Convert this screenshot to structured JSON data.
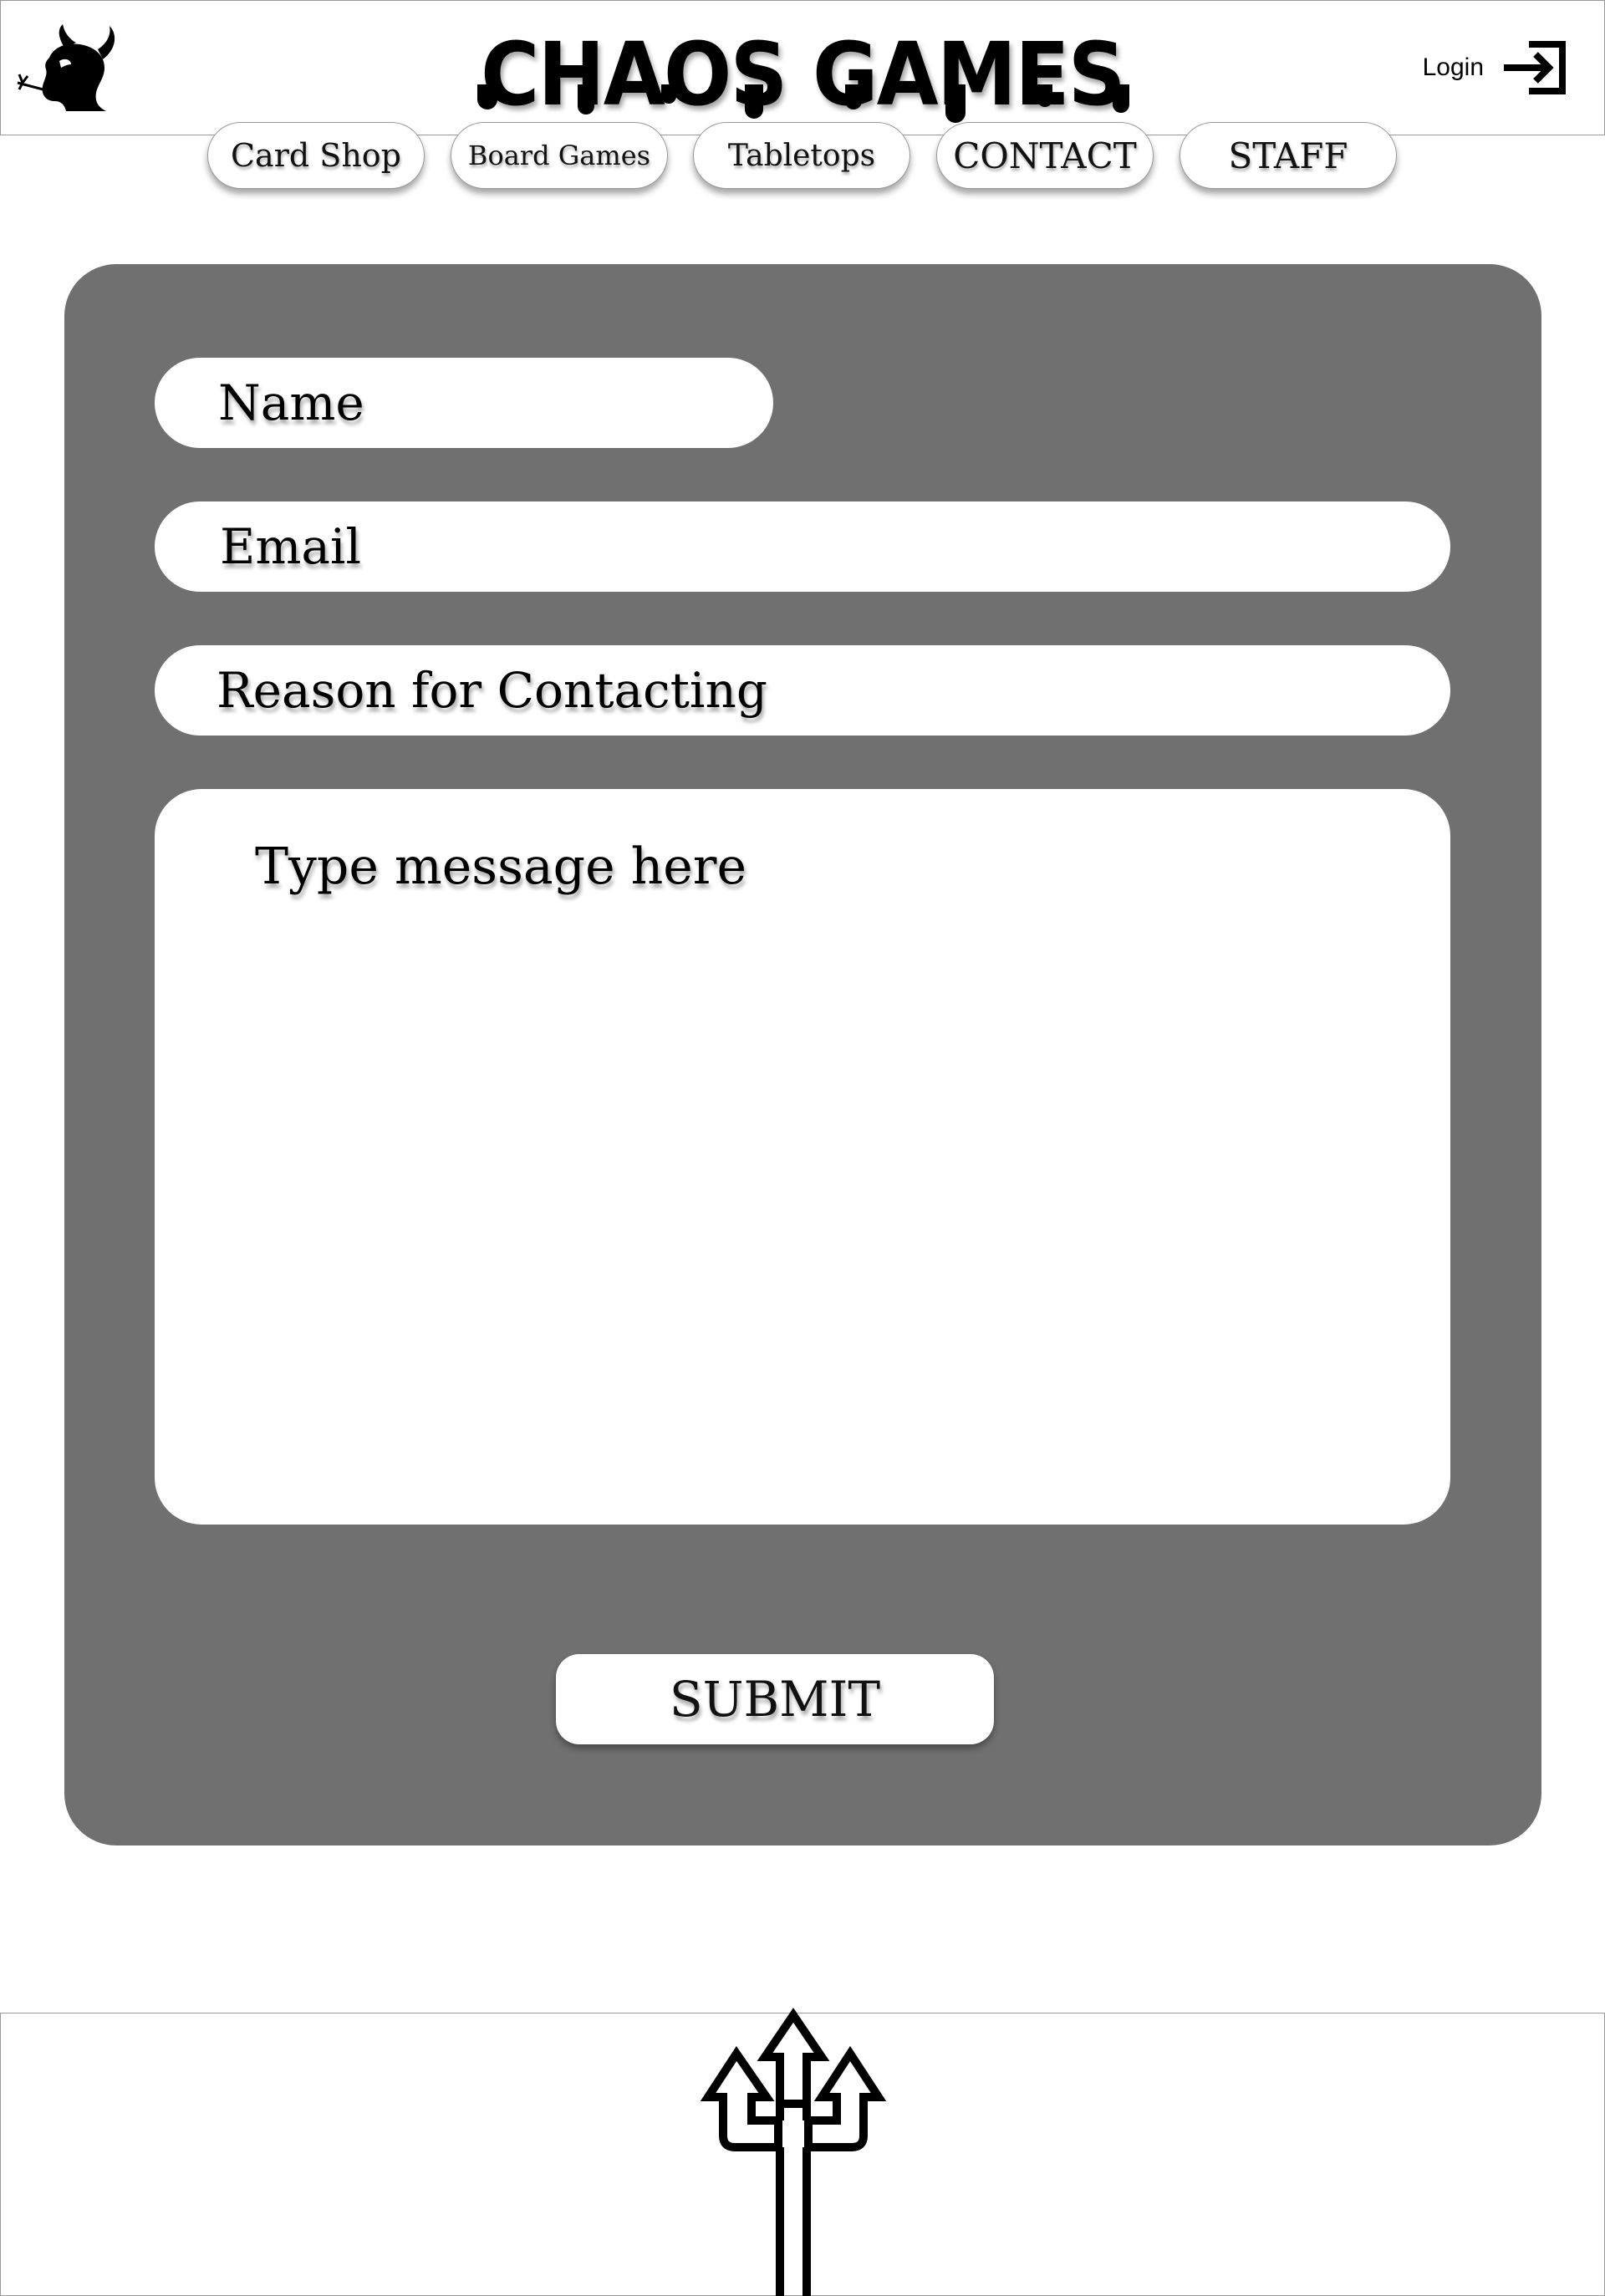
{
  "header": {
    "title": "CHAOS GAMES",
    "logo_icon": "devil-head-icon",
    "login_label": "Login",
    "login_icon": "login-arrow-icon"
  },
  "nav": {
    "tabs": [
      {
        "label": "Card Shop"
      },
      {
        "label": "Board Games"
      },
      {
        "label": "Tabletops"
      },
      {
        "label": "CONTACT"
      },
      {
        "label": "STAFF"
      }
    ]
  },
  "form": {
    "name_placeholder": "Name",
    "email_placeholder": "Email",
    "reason_placeholder": "Reason for Contacting",
    "message_placeholder": "Type message here",
    "submit_label": "SUBMIT"
  },
  "footer": {
    "icon": "trident-icon"
  },
  "colors": {
    "panel": "#707070",
    "background": "#ffffff",
    "text": "#000000"
  }
}
